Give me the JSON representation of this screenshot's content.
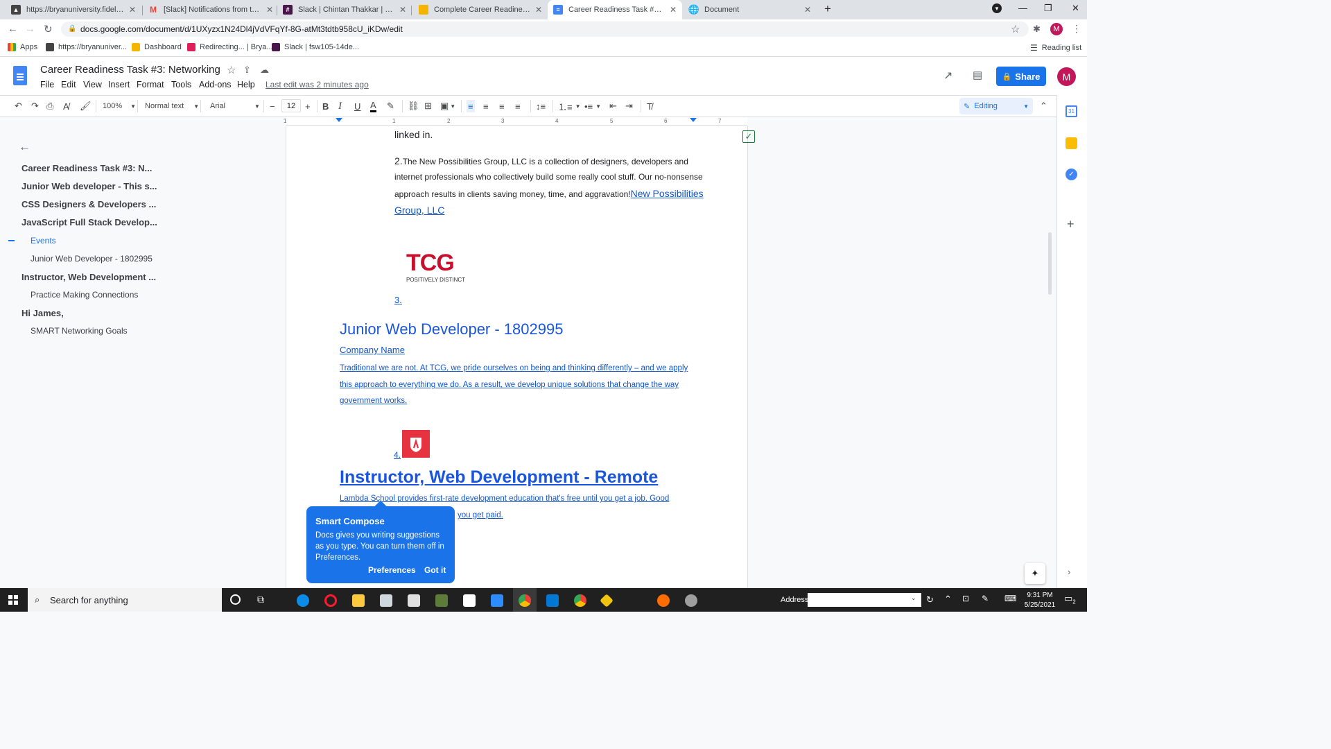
{
  "browser": {
    "tabs": [
      {
        "title": "https://bryanuniversity.fideliseduc",
        "icon": "bryan-university-icon"
      },
      {
        "title": "[Slack] Notifications from the Bry",
        "icon": "gmail-icon"
      },
      {
        "title": "Slack | Chintan Thakkar | Bryan U",
        "icon": "slack-icon"
      },
      {
        "title": "Complete Career Readiness Task",
        "icon": "bookmark-doc-icon"
      },
      {
        "title": "Career Readiness Task #3: Netwo",
        "icon": "docs-icon"
      },
      {
        "title": "Document",
        "icon": "globe-icon"
      }
    ],
    "url": "docs.google.com/document/d/1UXyzx1N24Dl4jVdVFqYf-8G-atMt3tdtb958cU_iKDw/edit",
    "profile_initial": "M",
    "bookmarks": [
      "Apps",
      "https://bryanuniver...",
      "Dashboard",
      "Redirecting... | Brya...",
      "Slack | fsw105-14de..."
    ],
    "reading_list": "Reading list"
  },
  "docs": {
    "title": "Career Readiness Task #3: Networking",
    "menus": [
      "File",
      "Edit",
      "View",
      "Insert",
      "Format",
      "Tools",
      "Add-ons",
      "Help"
    ],
    "last_edit": "Last edit was 2 minutes ago",
    "share_label": "Share",
    "avatar_initial": "M",
    "toolbar": {
      "zoom": "100%",
      "style": "Normal text",
      "font": "Arial",
      "font_size": "12",
      "mode": "Editing"
    },
    "ruler_numbers": [
      "1",
      "1",
      "2",
      "3",
      "4",
      "5",
      "6",
      "7"
    ]
  },
  "outline": {
    "items": [
      {
        "label": "Career Readiness Task #3: N...",
        "level": "heading"
      },
      {
        "label": "Junior Web developer - This s...",
        "level": "heading"
      },
      {
        "label": "CSS Designers & Developers ...",
        "level": "heading"
      },
      {
        "label": "JavaScript Full Stack Develop...",
        "level": "heading"
      },
      {
        "label": "Events",
        "level": "sub-active"
      },
      {
        "label": "Junior Web Developer - 1802995",
        "level": "sub"
      },
      {
        "label": "Instructor, Web Development ...",
        "level": "heading"
      },
      {
        "label": "Practice Making Connections",
        "level": "sub"
      },
      {
        "label": "Hi James,",
        "level": "heading"
      },
      {
        "label": "SMART Networking Goals",
        "level": "sub"
      }
    ]
  },
  "document": {
    "line_top": "linked in.",
    "item2_num": "2.",
    "item2_l1": "The New Possibilities Group, LLC is a collection of designers, developers and",
    "item2_l2": "internet professionals who collectively build some really cool stuff. Our no-nonsense",
    "item2_l3": "approach results in clients saving money, time, and aggravation!",
    "item2_link_a": "New Possibilities",
    "item2_link_b": "Group, LLC",
    "tcg_logo": "TCG",
    "tcg_tag": "POSITIVELY DISTINCT",
    "item3_num": "3.",
    "heading_junior": "Junior Web Developer - 1802995",
    "company_name": "Company Name",
    "tcg_l1": "Traditional we are not. At TCG, we pride ourselves on being and thinking differently – and we apply",
    "tcg_l2": "this approach to everything we do. As a result, we develop unique solutions that change the way",
    "tcg_l3": "government works.",
    "item4_num": "4.",
    "heading_instructor": "Instructor, Web Development - Remote",
    "lambda_l1": "Lambda School provides first-rate development education that's free until you get a job. Good",
    "lambda_l2": "you get paid."
  },
  "popup": {
    "title": "Smart Compose",
    "body": "Docs gives you writing suggestions as you type. You can turn them off in Preferences.",
    "preferences": "Preferences",
    "got_it": "Got it"
  },
  "taskbar": {
    "search_placeholder": "Search for anything",
    "address_label": "Address",
    "time": "9:31 PM",
    "date": "5/25/2021",
    "notifications": "2"
  },
  "colors": {
    "docs_blue": "#1a73e8",
    "link": "#1155cc",
    "tcg_red": "#c8102e",
    "lambda_red": "#e6333f"
  }
}
